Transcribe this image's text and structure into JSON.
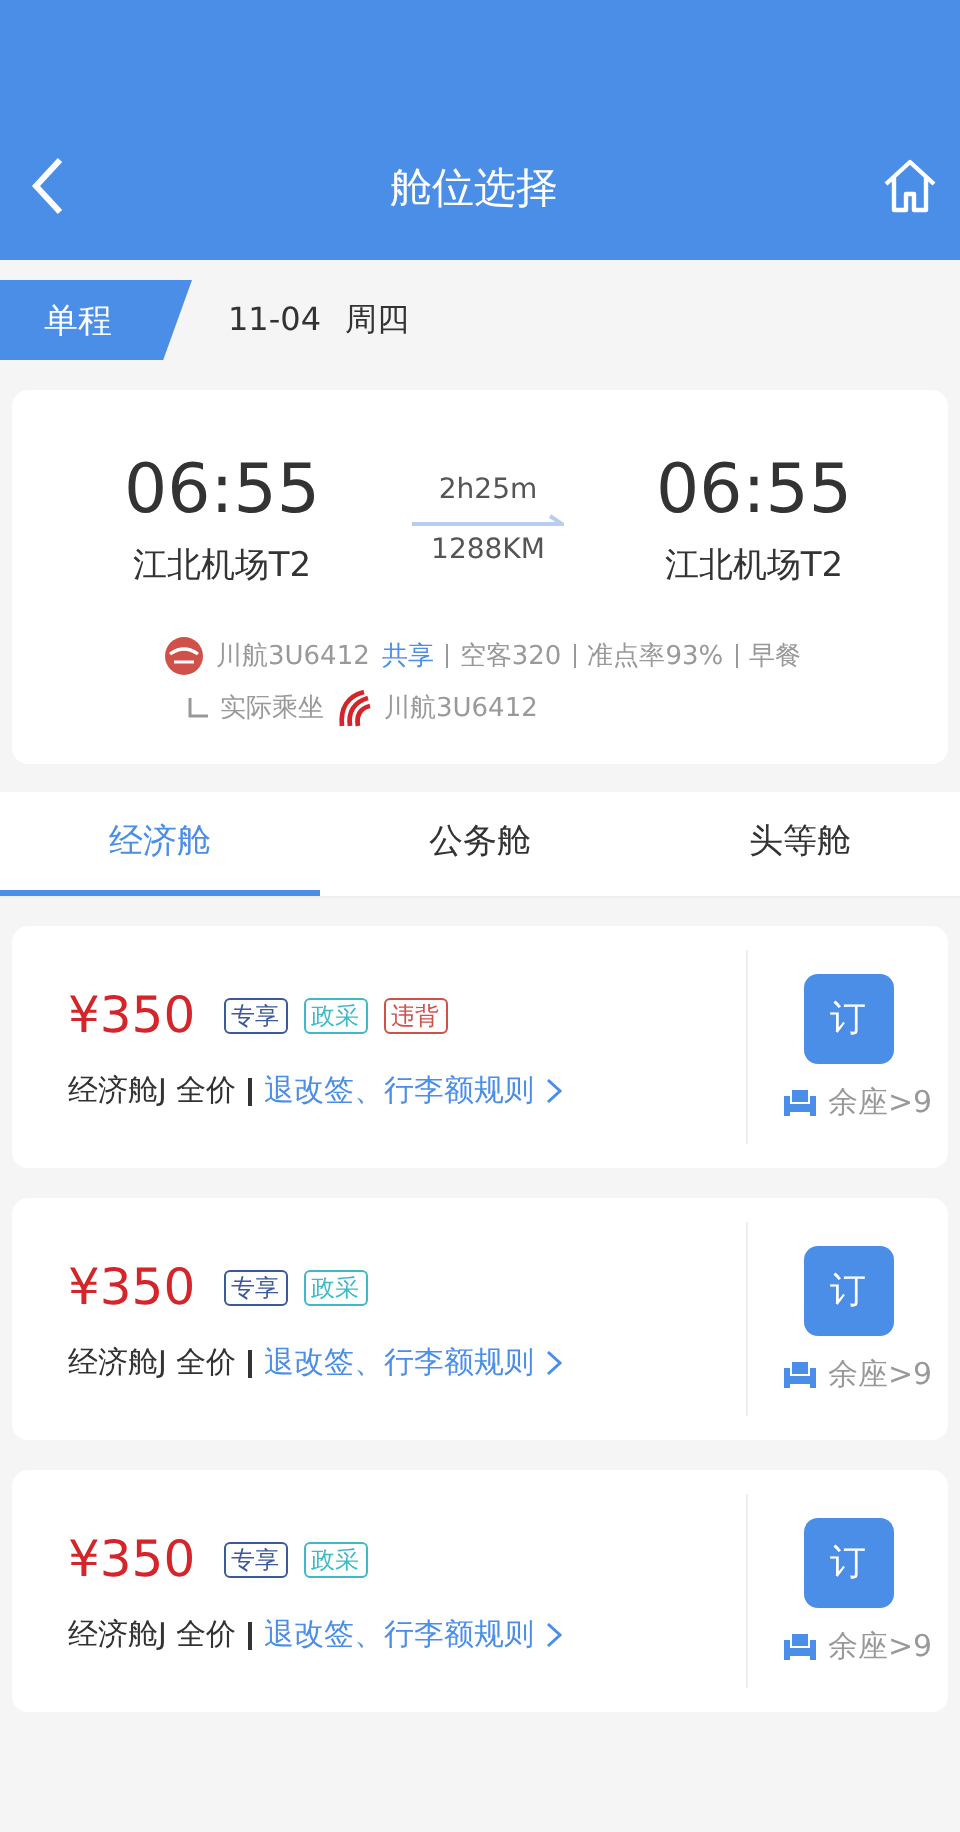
{
  "header": {
    "title": "舱位选择"
  },
  "trip": {
    "type_label": "单程",
    "date": "11-04",
    "weekday": "周四"
  },
  "flight": {
    "departure": {
      "time": "06:55",
      "airport": "江北机场T2"
    },
    "duration": "2h25m",
    "distance": "1288KM",
    "arrival": {
      "time": "06:55",
      "airport": "江北机场T2"
    },
    "airline": "川航3U6412",
    "share_tag": "共享",
    "details": [
      "空客320",
      "准点率93%",
      "早餐"
    ],
    "actual_label": "实际乘坐",
    "actual_airline": "川航3U6412"
  },
  "tabs": [
    {
      "label": "经济舱",
      "selected": true
    },
    {
      "label": "公务舱",
      "selected": false
    },
    {
      "label": "头等舱",
      "selected": false
    }
  ],
  "fares": [
    {
      "price": "¥350",
      "tags": [
        {
          "label": "专享",
          "color": "#3a5a9c"
        },
        {
          "label": "政采",
          "color": "#3fb8c8"
        },
        {
          "label": "违背",
          "color": "#d0504a"
        }
      ],
      "cabin": "经济舱J 全价",
      "rules": "退改签、行李额规则",
      "book": "订",
      "seats": "余座>9"
    },
    {
      "price": "¥350",
      "tags": [
        {
          "label": "专享",
          "color": "#3a5a9c"
        },
        {
          "label": "政采",
          "color": "#3fb8c8"
        }
      ],
      "cabin": "经济舱J 全价",
      "rules": "退改签、行李额规则",
      "book": "订",
      "seats": "余座>9"
    },
    {
      "price": "¥350",
      "tags": [
        {
          "label": "专享",
          "color": "#3a5a9c"
        },
        {
          "label": "政采",
          "color": "#3fb8c8"
        }
      ],
      "cabin": "经济舱J 全价",
      "rules": "退改签、行李额规则",
      "book": "订",
      "seats": "余座>9"
    }
  ]
}
